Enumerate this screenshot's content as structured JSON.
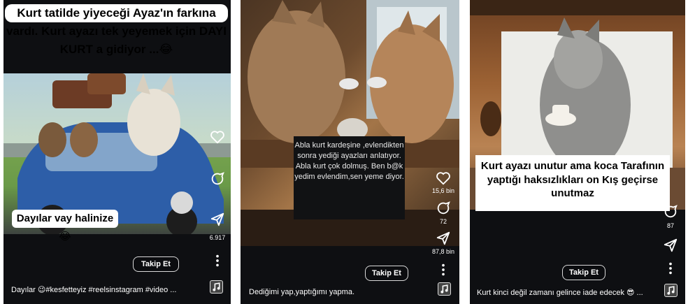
{
  "panels": [
    {
      "top_text": "Kurt tatilde yiyeceği Ayaz'ın farkına vardı. Kurt ayazı tek yeyemek için DAYI KURT a gidiyor ...😂",
      "overlay_text": "Dayılar vay halinize 😂",
      "share_count": "6.917",
      "follow_label": "Takip Et",
      "caption": "Dayılar 😉#kesfetteyiz #reelsinstagram #video ..."
    },
    {
      "overlay_text": "Abla kurt kardeşine ,evlendikten sonra yediği ayazları anlatıyor. Abla kurt çok dolmuş. Ben b@k yedim evlendim,sen yeme diyor.",
      "like_count": "15,6 bin",
      "comment_count": "72",
      "share_count": "87,8 bin",
      "follow_label": "Takip Et",
      "caption": "Dediğimi yap,yaptığımı yapma."
    },
    {
      "overlay_text": "Kurt ayazı unutur ama koca Tarafının yaptığı haksızlıkları on Kış geçirse unutmaz",
      "comment_count": "87",
      "follow_label": "Takip Et",
      "caption": "Kurt kinci değil zamanı gelince iade edecek 😎 ..."
    }
  ],
  "colors": {
    "panel_bg": "#0e0f12",
    "text_light": "#ffffff"
  },
  "icons": [
    "heart-icon",
    "comment-icon",
    "share-icon",
    "more-icon",
    "music-icon"
  ]
}
